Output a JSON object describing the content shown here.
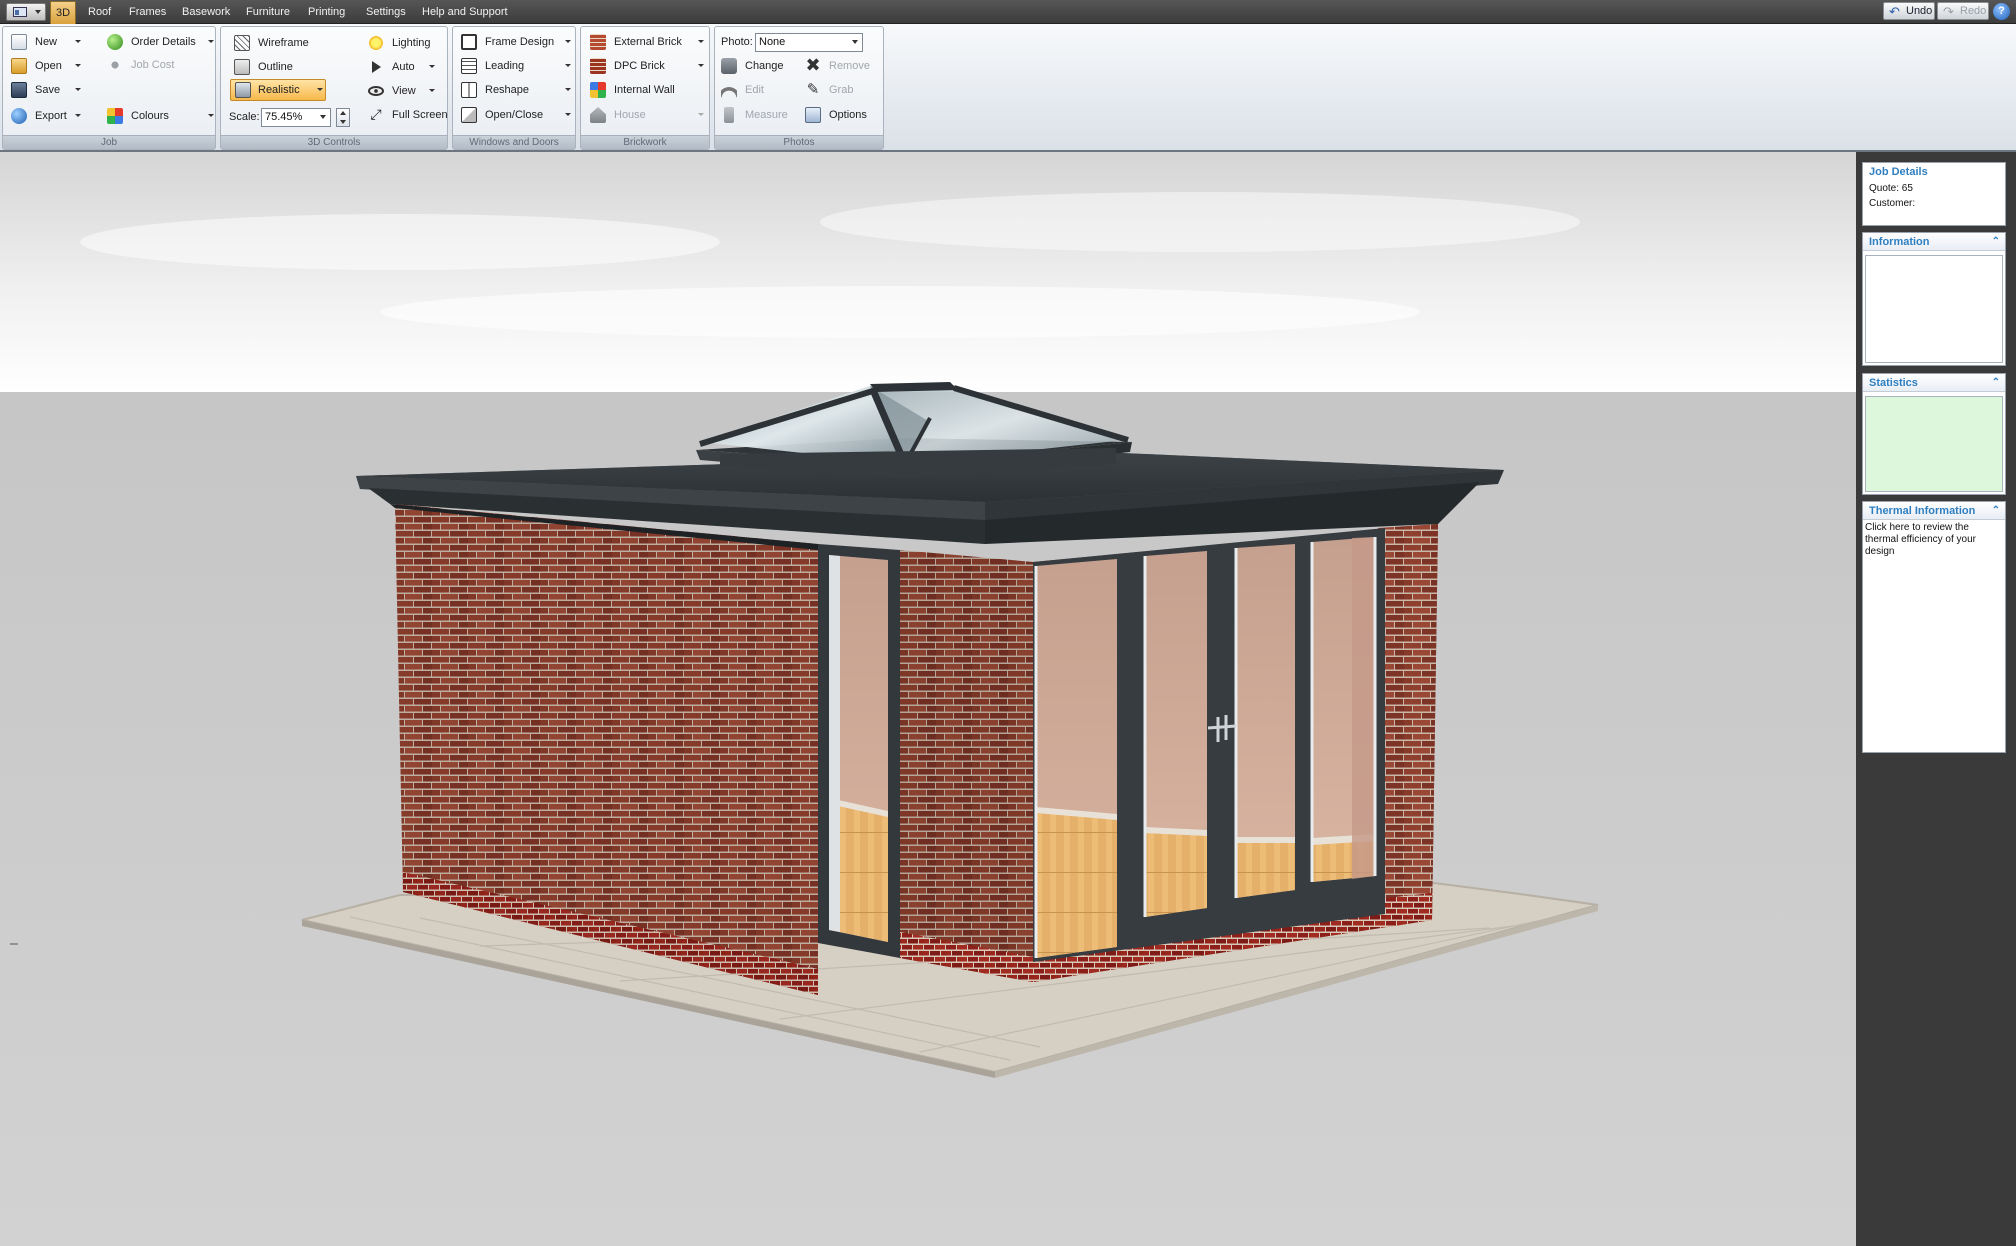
{
  "menubar": {
    "tabs": [
      "3D",
      "Roof",
      "Frames",
      "Basework",
      "Furniture",
      "Printing",
      "Settings",
      "Help and Support"
    ],
    "active_tab": "3D",
    "undo_label": "Undo",
    "redo_label": "Redo",
    "help_label": "?"
  },
  "ribbon": {
    "job": {
      "footer": "Job",
      "new": "New",
      "open": "Open",
      "save": "Save",
      "export": "Export",
      "order_details": "Order Details",
      "job_cost": "Job Cost",
      "colours": "Colours"
    },
    "controls3d": {
      "footer": "3D Controls",
      "wireframe": "Wireframe",
      "outline": "Outline",
      "realistic": "Realistic",
      "scale_label": "Scale:",
      "scale_value": "75.45%",
      "lighting": "Lighting",
      "auto": "Auto",
      "view": "View",
      "full_screen": "Full Screen"
    },
    "windows_doors": {
      "footer": "Windows and Doors",
      "frame_design": "Frame Design",
      "leading": "Leading",
      "reshape": "Reshape",
      "open_close": "Open/Close"
    },
    "brickwork": {
      "footer": "Brickwork",
      "external_brick": "External Brick",
      "dpc_brick": "DPC Brick",
      "internal_wall": "Internal Wall",
      "house": "House"
    },
    "photos": {
      "footer": "Photos",
      "photo_label": "Photo:",
      "photo_value": "None",
      "change": "Change",
      "remove": "Remove",
      "edit": "Edit",
      "grab": "Grab",
      "measure": "Measure",
      "options": "Options"
    }
  },
  "side": {
    "job_details": {
      "title": "Job Details",
      "quote": "Quote: 65",
      "customer": "Customer:"
    },
    "information": {
      "title": "Information"
    },
    "statistics": {
      "title": "Statistics"
    },
    "thermal": {
      "title": "Thermal Information",
      "text": "Click here to review the thermal efficiency of your design"
    }
  },
  "colors": {
    "statistics_bg": "#ddf7dd",
    "brick": "#8a3e2c",
    "frame": "#3b4145",
    "accent": "#2f7fc0"
  }
}
